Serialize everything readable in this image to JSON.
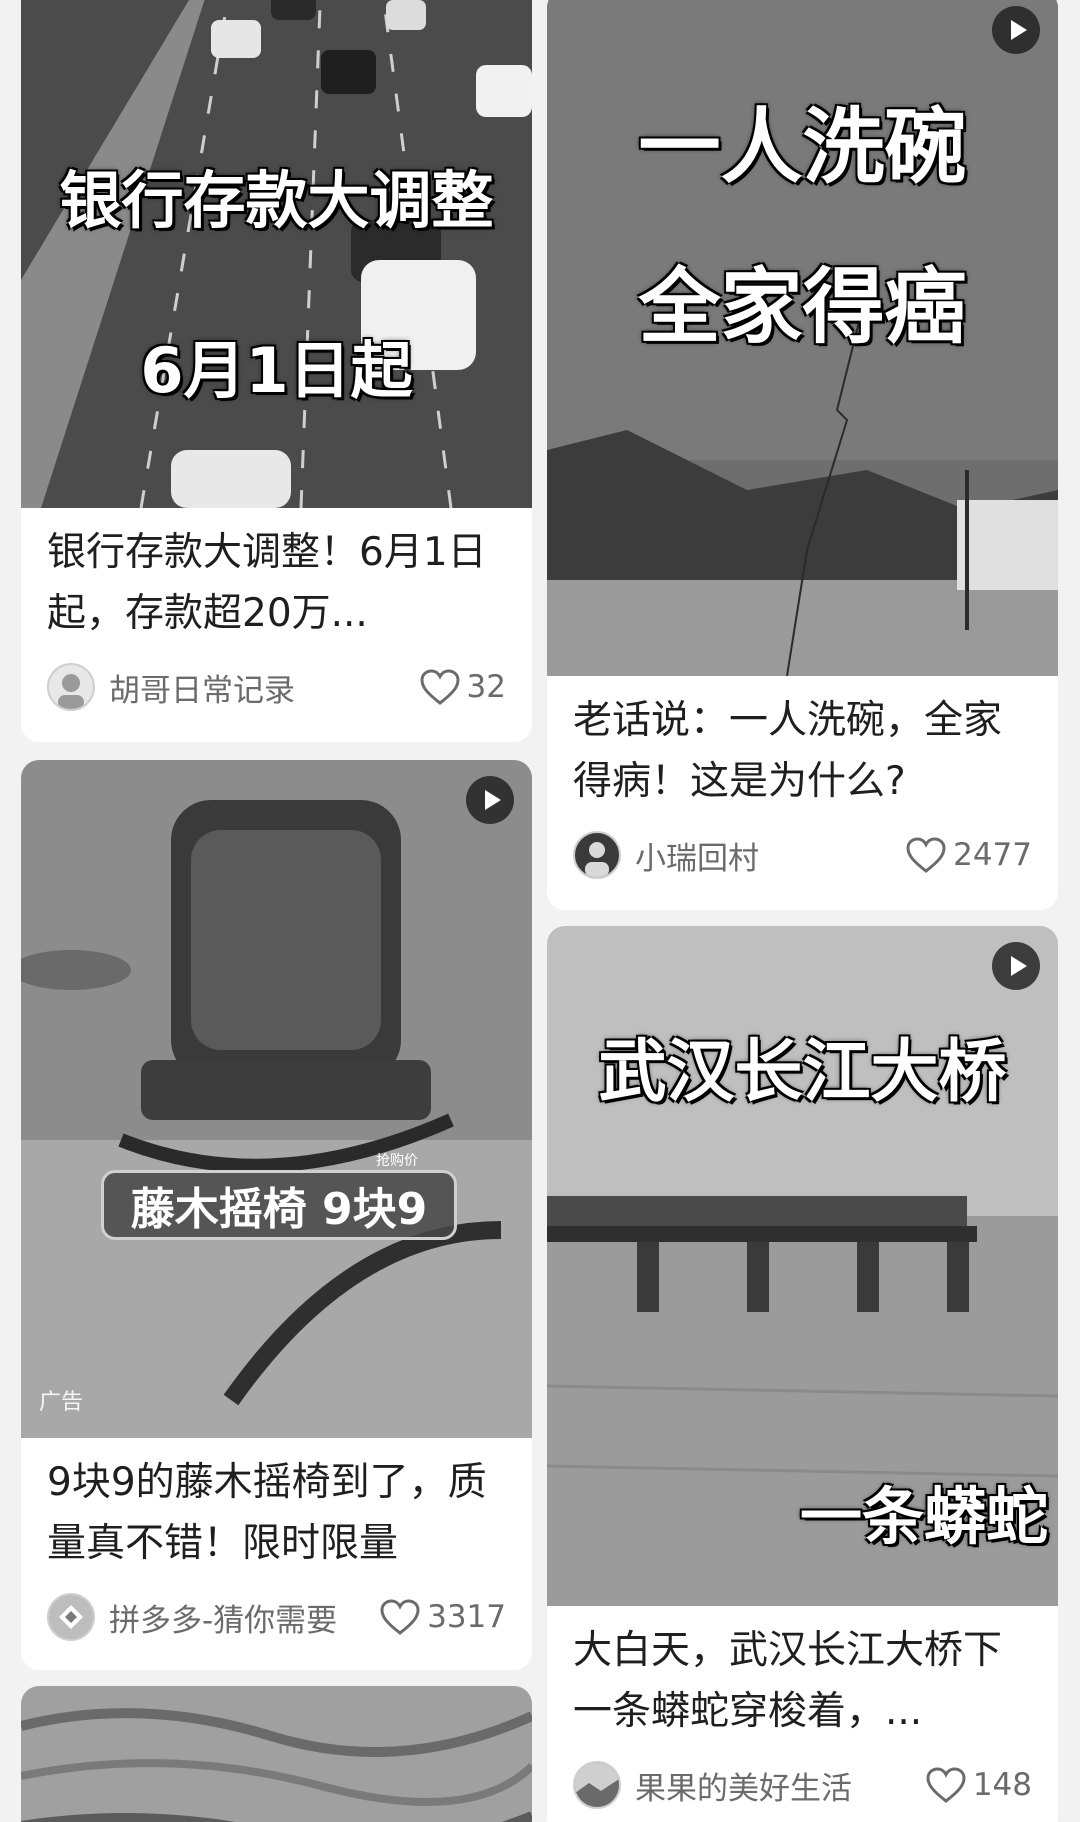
{
  "cards": [
    {
      "overlay_line1": "银行存款大调整",
      "overlay_line2": "6月1日起",
      "title": "银行存款大调整！6月1日起，存款超20万...",
      "author": "胡哥日常记录",
      "likes": "32"
    },
    {
      "overlay_line1": "一人洗碗",
      "overlay_line2": "全家得癌",
      "title": "老话说：一人洗碗，全家得病！这是为什么?",
      "author": "小瑞回村",
      "likes": "2477"
    },
    {
      "overlay_price": "藤木摇椅 9块9",
      "overlay_small": "抢购价",
      "ad_label": "广告",
      "title": "9块9的藤木摇椅到了，质量真不错！限时限量",
      "author": "拼多多-猜你需要",
      "likes": "3317"
    },
    {
      "overlay_line1": "武汉长江大桥",
      "overlay_line2": "一条蟒蛇",
      "title": "大白天，武汉长江大桥下一条蟒蛇穿梭着，...",
      "author": "果果的美好生活",
      "likes": "148"
    }
  ],
  "icons": {
    "play": "play-icon",
    "like": "heart-icon"
  },
  "colors": {
    "background": "#f2f2f2",
    "card": "#ffffff",
    "meta_text": "#6b6b6b"
  }
}
